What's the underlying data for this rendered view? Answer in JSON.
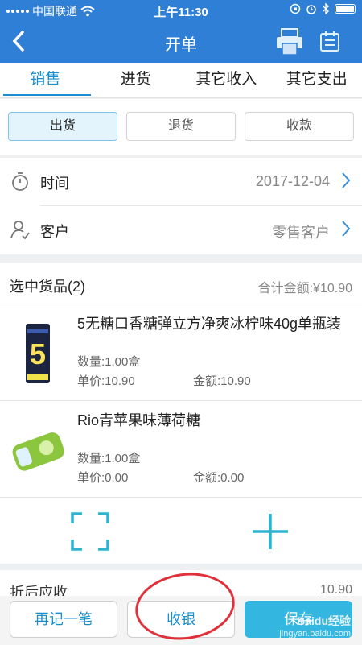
{
  "status_bar": {
    "carrier": "中国联通",
    "time": "上午11:30"
  },
  "nav": {
    "title": "开单"
  },
  "tabs": [
    {
      "label": "销售",
      "active": true
    },
    {
      "label": "进货",
      "active": false
    },
    {
      "label": "其它收入",
      "active": false
    },
    {
      "label": "其它支出",
      "active": false
    }
  ],
  "segment": [
    {
      "label": "出货",
      "active": true
    },
    {
      "label": "退货",
      "active": false
    },
    {
      "label": "收款",
      "active": false
    }
  ],
  "rows": {
    "time": {
      "label": "时间",
      "value": "2017-12-04"
    },
    "customer": {
      "label": "客户",
      "value": "零售客户"
    }
  },
  "goods": {
    "title": "选中货品(2)",
    "total": "合计金额:¥10.90",
    "items": [
      {
        "name": "5无糖口香糖弹立方净爽冰柠味40g单瓶装",
        "qty": "数量:1.00盒",
        "price": "单价:10.90",
        "amount": "金额:10.90"
      },
      {
        "name": "Rio青苹果味薄荷糖",
        "qty": "数量:1.00盒",
        "price": "单价:0.00",
        "amount": "金额:0.00"
      }
    ]
  },
  "summary": {
    "label": "折后应收",
    "value": "10.90"
  },
  "bottom": {
    "again": "再记一笔",
    "checkout": "收银",
    "save": "保存"
  },
  "watermark": {
    "brand": "Baidu经验",
    "url": "jingyan.baidu.com"
  },
  "colors": {
    "nav": "#2f7fd6",
    "accent": "#1a8fcf",
    "primary_button": "#33b6e0",
    "annotation": "#e0303a"
  }
}
